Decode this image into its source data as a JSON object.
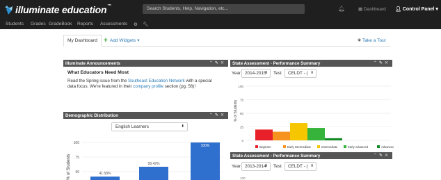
{
  "header": {
    "logo_text": "illuminate education",
    "logo_tm": "™",
    "search_placeholder": "Search Students, Help, Navigation, etc...",
    "dashboard_label": "Dashboard",
    "control_panel_label": "Control Panel"
  },
  "nav": {
    "items": [
      "Students",
      "Grades",
      "GradeBook",
      "Reports",
      "Assessments"
    ]
  },
  "tabs": {
    "my_dashboard": "My Dashboard",
    "add_widgets": "Add Widgets",
    "take_tour": "Take a Tour"
  },
  "announcements": {
    "header": "Illuminate Announcements",
    "title": "What Educators Need Most",
    "body_part1": "Read the Spring issue from the ",
    "link1": "Southeast Education Network",
    "body_part2": " with a special data focus. We're featured in their ",
    "link2": "company profile",
    "body_part3": " section (pg. 56)!"
  },
  "demographic": {
    "header": "Demographic Distribution",
    "select_value": "English Learners",
    "y_label": "% of Students"
  },
  "state_assessment_1": {
    "header": "State Assessment - Performance Summary",
    "year_label": "Year",
    "year_value": "2014-2015",
    "test_label": "Test",
    "test_value": "CELDT - (",
    "y_label": "% of Students"
  },
  "state_assessment_2": {
    "header": "State Assessment - Performance Summary",
    "year_label": "Year",
    "year_value": "2013-2014",
    "test_label": "Test",
    "test_value": "CELDT - (",
    "y_tick_visible": "100"
  },
  "colors": {
    "topbar": "#1f1f1f",
    "panel_header": "#555555",
    "link": "#2a7ab5",
    "beginner": "#e8202a",
    "early_intermediate": "#f7921e",
    "intermediate": "#f6c600",
    "early_advanced": "#36b33a",
    "advanced": "#138a24",
    "demo_bar": "#2f6fce"
  },
  "chart_data": [
    {
      "type": "bar",
      "title": "",
      "ylabel": "% of Students",
      "ylim": [
        0,
        100
      ],
      "yticks": [
        50,
        75,
        100
      ],
      "series": [
        {
          "values": [
            41.58,
            58.42,
            100
          ]
        }
      ],
      "data_labels": [
        "41.58%",
        "58.42%",
        "100%"
      ]
    },
    {
      "type": "bar",
      "title": "",
      "ylabel": "% of Students",
      "ylim": [
        0,
        100
      ],
      "yticks": [
        0,
        25,
        50,
        75,
        100
      ],
      "categories": [
        "Beginner",
        "Early Intermediate",
        "Intermediate",
        "Early Advanced",
        "Advanced"
      ],
      "values": [
        20,
        16,
        32,
        23,
        4
      ],
      "legend": "bottom"
    }
  ]
}
